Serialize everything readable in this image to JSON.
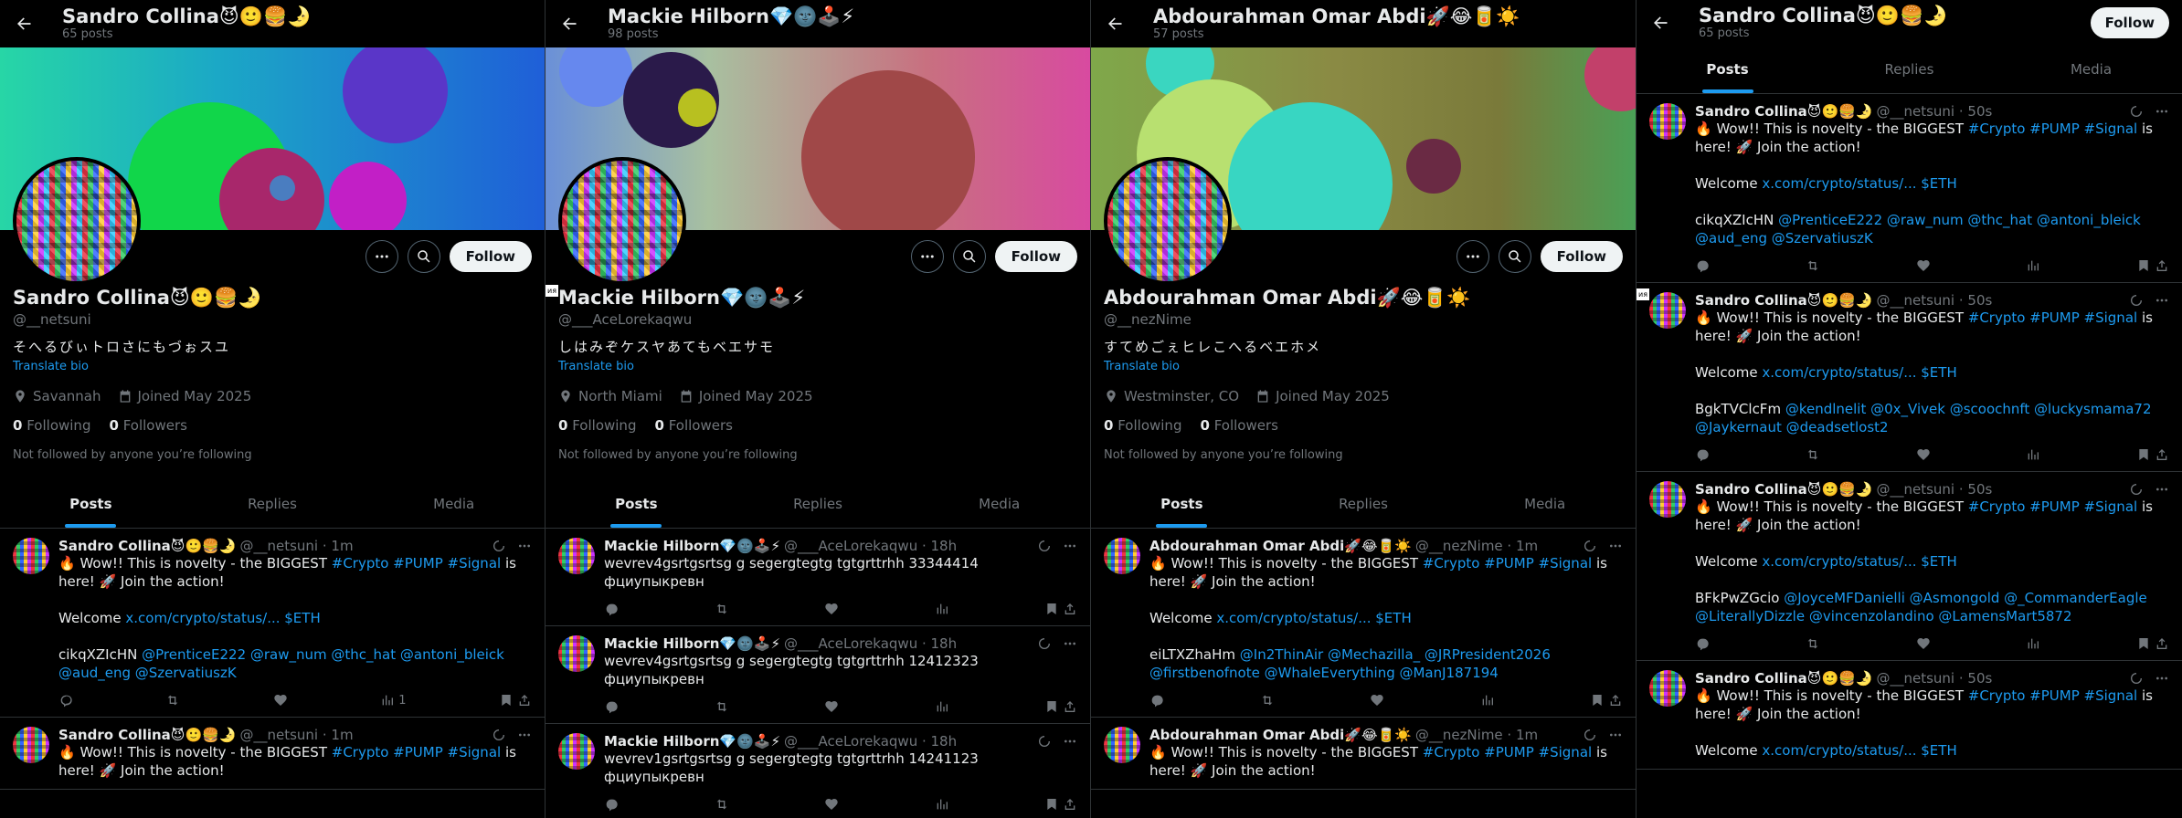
{
  "panels": [
    {
      "top_name": "Sandro Collina😈🙂🍔🌛",
      "top_posts": "65 posts",
      "banner": {
        "gradient": "linear-gradient(90deg,#2fd3a6 0%,#1fa7c7 45%,#1a5fd0 100%)",
        "circles": []
      },
      "name": "Sandro Collina😈🙂🍔🌛",
      "handle": "@__netsuni",
      "bio": "そへるびぃトロさにもづぉスユ",
      "translate": "Translate bio",
      "location": "Savannah",
      "joined": "Joined May 2025",
      "following_count": "0",
      "following_label": "Following",
      "followers_count": "0",
      "followers_label": "Followers",
      "not_followed": "Not followed by anyone you’re following",
      "tabs": [
        "Posts",
        "Replies",
        "Media"
      ],
      "follow_label": "Follow",
      "posts": [
        {
          "name": "Sandro Collina😈🙂🍔🌛",
          "meta": "@__netsuni · 1m",
          "line1a": "🔥 Wow!! This is novelty - the BIGGEST ",
          "line1b": "#Crypto #PUMP #Signal",
          "line1c": " is here! 🚀 Join the action!",
          "welcome": "Welcome ",
          "welcome_link": "x.com/crypto/status/... $ETH",
          "tag_prefix": "cikqXZIcHN ",
          "tags": "@PrenticeE222 @raw_num @thc_hat @antoni_bleick @aud_eng @SzervatiuszK",
          "views": "1"
        },
        {
          "name": "Sandro Collina😈🙂🍔🌛",
          "meta": "@__netsuni · 1m",
          "line1a": "🔥 Wow!! This is novelty - the BIGGEST ",
          "line1b": "#Crypto #PUMP #Signal",
          "line1c": " is here! 🚀 Join the action!"
        }
      ]
    },
    {
      "top_name": "Mackie Hilborn💎🌚🕹️⚡",
      "top_posts": "98 posts",
      "name": "Mackie Hilborn💎🌚🕹️⚡",
      "handle": "@___AceLorekaqwu",
      "bio": "しはみぞケスヤあてもベエサモ",
      "translate": "Translate bio",
      "location": "North Miami",
      "joined": "Joined May 2025",
      "following_count": "0",
      "following_label": "Following",
      "followers_count": "0",
      "followers_label": "Followers",
      "not_followed": "Not followed by anyone you’re following",
      "tabs": [
        "Posts",
        "Replies",
        "Media"
      ],
      "follow_label": "Follow",
      "tiny_tag": "ия",
      "posts": [
        {
          "name": "Mackie Hilborn💎🌚🕹️⚡",
          "meta": "@___AceLorekaqwu · 18h",
          "text": "wevrev4gsrtgsrtsg g segergtegtg tgtgrttrhh 33344414 фциупыкревн"
        },
        {
          "name": "Mackie Hilborn💎🌚🕹️⚡",
          "meta": "@___AceLorekaqwu · 18h",
          "text": "wevrev4gsrtgsrtsg g segergtegtg tgtgrttrhh 12412323 фциупыкревн"
        },
        {
          "name": "Mackie Hilborn💎🌚🕹️⚡",
          "meta": "@___AceLorekaqwu · 18h",
          "text": "wevrev1gsrtgsrtsg g segergtegtg tgtgrttrhh 14241123 фциупыкревн"
        }
      ]
    },
    {
      "top_name": "Abdourahman Omar Abdi🚀😂🥫☀️",
      "top_posts": "57 posts",
      "name": "Abdourahman Omar Abdi🚀😂🥫☀️",
      "handle": "@__nezNime",
      "bio": "すてめごぇヒレこへるベエホメ",
      "translate": "Translate bio",
      "location": "Westminster, CO",
      "joined": "Joined May 2025",
      "following_count": "0",
      "following_label": "Following",
      "followers_count": "0",
      "followers_label": "Followers",
      "not_followed": "Not followed by anyone you’re following",
      "tabs": [
        "Posts",
        "Replies",
        "Media"
      ],
      "follow_label": "Follow",
      "tiny_tag": "ия",
      "posts": [
        {
          "name": "Abdourahman Omar Abdi🚀😂🥫☀️",
          "meta": "@__nezNime · 1m",
          "line1a": "🔥 Wow!! This is novelty - the BIGGEST ",
          "line1b": "#Crypto #PUMP #Signal",
          "line1c": " is here! 🚀 Join the action!",
          "welcome": "Welcome ",
          "welcome_link": "x.com/crypto/status/... $ETH",
          "tag_prefix": "eiLTXZhaHm ",
          "tags": "@In2ThinAir @Mechazilla_ @JRPresident2026 @firstbenofnote @WhaleEverything @ManJ187194"
        },
        {
          "name": "Abdourahman Omar Abdi🚀😂🥫☀️",
          "meta": "@__nezNime · 1m",
          "line1a": "🔥 Wow!! This is novelty - the BIGGEST ",
          "line1b": "#Crypto #PUMP #Signal",
          "line1c": " is here! 🚀 Join the action!"
        }
      ]
    },
    {
      "top_name": "Sandro Collina😈🙂🍔🌛",
      "top_posts": "65 posts",
      "follow_label": "Follow",
      "tabs": [
        "Posts",
        "Replies",
        "Media"
      ],
      "posts": [
        {
          "name": "Sandro Collina😈🙂🍔🌛",
          "meta": "@__netsuni · 50s",
          "line1a": "🔥 Wow!! This is novelty - the BIGGEST ",
          "line1b": "#Crypto #PUMP #Signal",
          "line1c": " is here! 🚀 Join the action!",
          "welcome": "Welcome ",
          "welcome_link": "x.com/crypto/status/... $ETH",
          "tag_prefix": "cikqXZIcHN ",
          "tags": "@PrenticeE222 @raw_num @thc_hat @antoni_bleick @aud_eng @SzervatiuszK"
        },
        {
          "name": "Sandro Collina😈🙂🍔🌛",
          "meta": "@__netsuni · 50s",
          "line1a": "🔥 Wow!! This is novelty - the BIGGEST ",
          "line1b": "#Crypto #PUMP #Signal",
          "line1c": " is here! 🚀 Join the action!",
          "welcome": "Welcome ",
          "welcome_link": "x.com/crypto/status/... $ETH",
          "tag_prefix": "BgkTVClcFm ",
          "tags": "@kendlnelit @0x_Vivek @scoochnft @luckysmama72 @Jaykernaut @deadsetlost2"
        },
        {
          "name": "Sandro Collina😈🙂🍔🌛",
          "meta": "@__netsuni · 50s",
          "line1a": "🔥 Wow!! This is novelty - the BIGGEST ",
          "line1b": "#Crypto #PUMP #Signal",
          "line1c": " is here! 🚀 Join the action!",
          "welcome": "Welcome ",
          "welcome_link": "x.com/crypto/status/... $ETH",
          "tag_prefix": "BFkPwZGcio ",
          "tags": "@JoyceMFDanielli @Asmongold @_CommanderEagle @LiterallyDizzle @vincenzolandino @LamensMart5872"
        },
        {
          "name": "Sandro Collina😈🙂🍔🌛",
          "meta": "@__netsuni · 50s",
          "line1a": "🔥 Wow!! This is novelty - the BIGGEST ",
          "line1b": "#Crypto #PUMP #Signal",
          "line1c": " is here! 🚀 Join the action!",
          "welcome": "Welcome ",
          "welcome_link": "x.com/crypto/status/... $ETH"
        }
      ]
    }
  ]
}
